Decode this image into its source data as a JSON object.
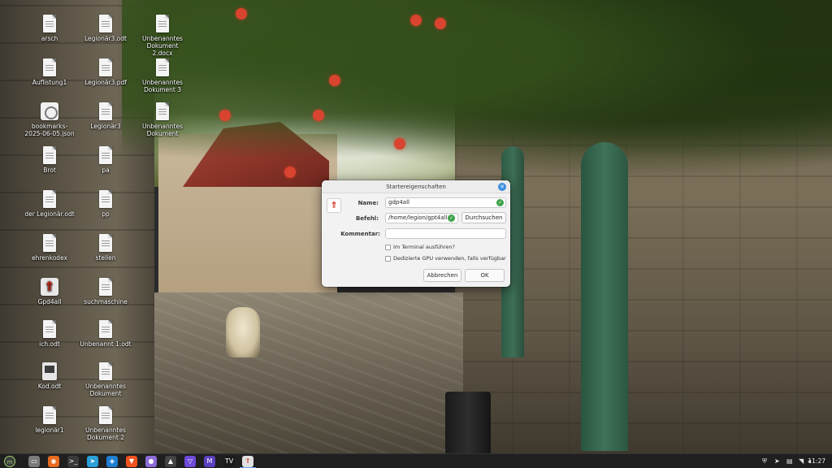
{
  "desktop": {
    "icons": [
      {
        "label": "arsch",
        "type": "file"
      },
      {
        "label": "Legionär3.odt",
        "type": "file"
      },
      {
        "label": "Unbenanntes Dokument 2.docx",
        "type": "file"
      },
      {
        "label": "Auflistung1",
        "type": "file"
      },
      {
        "label": "Legionär3.pdf",
        "type": "file"
      },
      {
        "label": "Unbenanntes Dokument 3",
        "type": "file"
      },
      {
        "label": "bookmarks-2025-06-05.json",
        "type": "json"
      },
      {
        "label": "Legionär3",
        "type": "file"
      },
      {
        "label": "Unbenanntes Dokument",
        "type": "file"
      },
      {
        "label": "Brot",
        "type": "file"
      },
      {
        "label": "pa",
        "type": "file"
      },
      {
        "label": "der Legionär.odt",
        "type": "file"
      },
      {
        "label": "pp",
        "type": "file"
      },
      {
        "label": "ehrenkodex",
        "type": "file"
      },
      {
        "label": "stellen",
        "type": "file"
      },
      {
        "label": "Gpd4all",
        "type": "app"
      },
      {
        "label": "suchmaschine",
        "type": "file"
      },
      {
        "label": "ich.odt",
        "type": "file"
      },
      {
        "label": "Unbenannt 1.odt",
        "type": "file"
      },
      {
        "label": "Kod.odt",
        "type": "media"
      },
      {
        "label": "Unbenanntes Dokument",
        "type": "file"
      },
      {
        "label": "legionär1",
        "type": "file"
      },
      {
        "label": "Unbenanntes Dokument 2",
        "type": "file"
      }
    ]
  },
  "dialog": {
    "title": "Startereigenschaften",
    "name_label": "Name:",
    "name_value": "gdp4all",
    "command_label": "Befehl:",
    "command_value": "/home/legion/gpt4all",
    "browse_label": "Durchsuchen",
    "comment_label": "Kommentar:",
    "comment_value": "",
    "run_in_terminal_label": "Im Terminal ausführen?",
    "run_in_terminal_checked": false,
    "dedicated_gpu_label": "Dedizierte GPU verwenden, falls verfügbar",
    "dedicated_gpu_checked": false,
    "cancel_label": "Abbrechen",
    "ok_label": "OK",
    "close_icon": "close-icon",
    "launcher_icon": "rocket-app-icon"
  },
  "taskbar": {
    "menu_icon": "mint-menu-icon",
    "apps": [
      {
        "name": "files-icon",
        "glyph": "▭",
        "color": "#7a7a7a"
      },
      {
        "name": "firefox-icon",
        "glyph": "◉",
        "color": "#e66a1f"
      },
      {
        "name": "terminal-icon",
        "glyph": ">_",
        "color": "#3a3a3a"
      },
      {
        "name": "telegram-icon",
        "glyph": "➤",
        "color": "#2a9fd8"
      },
      {
        "name": "vscode-icon",
        "glyph": "◈",
        "color": "#1f7fd1"
      },
      {
        "name": "brave-icon",
        "glyph": "▼",
        "color": "#f0521f"
      },
      {
        "name": "purple-app-icon",
        "glyph": "●",
        "color": "#8c6bd8"
      },
      {
        "name": "inkscape-icon",
        "glyph": "▲",
        "color": "#444"
      },
      {
        "name": "proton-vpn-icon",
        "glyph": "▽",
        "color": "#6d4ad8"
      },
      {
        "name": "mail-icon",
        "glyph": "M",
        "color": "#5a3fbf"
      },
      {
        "name": "tradingview-icon",
        "glyph": "TV",
        "color": "#1a1a1a"
      },
      {
        "name": "gpt4all-icon",
        "glyph": "⇑",
        "color": "#e0e0e0"
      }
    ],
    "tray": [
      "shield-icon",
      "telegram-tray-icon",
      "network-icon",
      "printer-icon",
      "wifi-icon",
      "volume-icon"
    ],
    "clock": "11:27"
  }
}
